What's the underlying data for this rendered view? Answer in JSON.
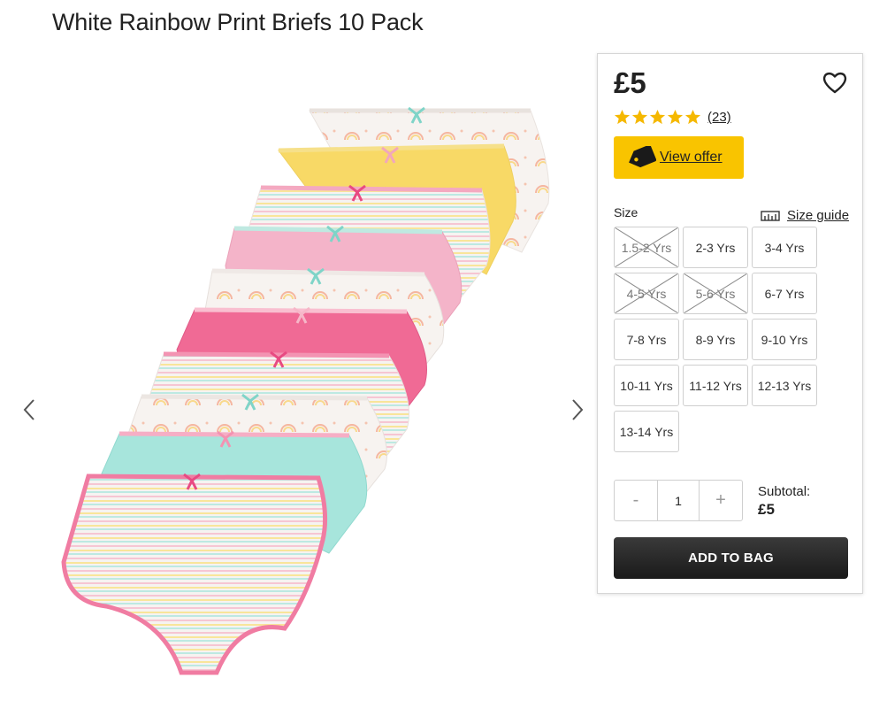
{
  "product": {
    "title": "White Rainbow Print Briefs 10 Pack",
    "price": "£5",
    "review_count": "(23)",
    "rating_stars": 5
  },
  "offer": {
    "label": "View offer"
  },
  "size": {
    "label": "Size",
    "guide_label": "Size guide",
    "options": [
      {
        "label": "1.5-2 Yrs",
        "available": false
      },
      {
        "label": "2-3 Yrs",
        "available": true
      },
      {
        "label": "3-4 Yrs",
        "available": true
      },
      {
        "label": "4-5 Yrs",
        "available": false
      },
      {
        "label": "5-6 Yrs",
        "available": false
      },
      {
        "label": "6-7 Yrs",
        "available": true
      },
      {
        "label": "7-8 Yrs",
        "available": true
      },
      {
        "label": "8-9 Yrs",
        "available": true
      },
      {
        "label": "9-10 Yrs",
        "available": true
      },
      {
        "label": "10-11 Yrs",
        "available": true
      },
      {
        "label": "11-12 Yrs",
        "available": true
      },
      {
        "label": "12-13 Yrs",
        "available": true
      },
      {
        "label": "13-14 Yrs",
        "available": true
      }
    ]
  },
  "quantity": {
    "minus": "-",
    "value": "1",
    "plus": "+"
  },
  "subtotal": {
    "label": "Subtotal:",
    "value": "£5"
  },
  "cart": {
    "add_label": "ADD TO BAG"
  },
  "colors": {
    "accent_yellow": "#f9c400",
    "star": "#f5b800",
    "button_dark": "#222222"
  },
  "icons": [
    "chevron-left-icon",
    "chevron-right-icon",
    "heart-icon",
    "star-icon",
    "tag-icon",
    "ruler-icon"
  ]
}
